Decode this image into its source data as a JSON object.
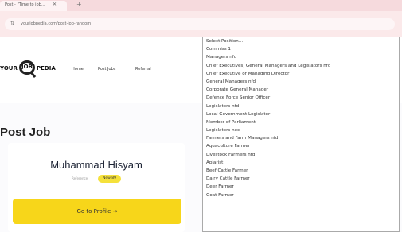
{
  "browser": {
    "tab_title": "Post - \"Time to job...",
    "tab_close": "✕",
    "new_tab": "+",
    "url_icon": "⇅",
    "url": "yourjobpedia.com/post-job-random"
  },
  "header": {
    "logo": {
      "your": "YOUR",
      "job": "JOB",
      "pedia": "PEDIA"
    },
    "nav": [
      "Home",
      "Post Jobs",
      "Referral"
    ]
  },
  "main": {
    "page_title": "Post Job",
    "profile": {
      "name": "Muhammad Hisyam",
      "role_label": "Reference",
      "role_badge": "New 89",
      "button_label": "Go to Profile →"
    }
  },
  "dropdown": {
    "selected_index": 22,
    "options": [
      "Select Position...",
      "Commiss 1",
      "Managers nfd",
      "Chief Executives, General Managers and Legislators nfd",
      "Chief Executive or Managing Director",
      "General Managers nfd",
      "Corporate General Manager",
      "Defence Force Senior Officer",
      "Legislators nfd",
      "Local Government Legislator",
      "Member of Parliament",
      "Legislators nec",
      "Farmers and Farm Managers nfd",
      "Aquaculture Farmer",
      "Livestock Farmers nfd",
      "Apiarist",
      "Beef Cattle Farmer",
      "Dairy Cattle Farmer",
      "Deer Farmer",
      "Goat Farmer"
    ]
  }
}
